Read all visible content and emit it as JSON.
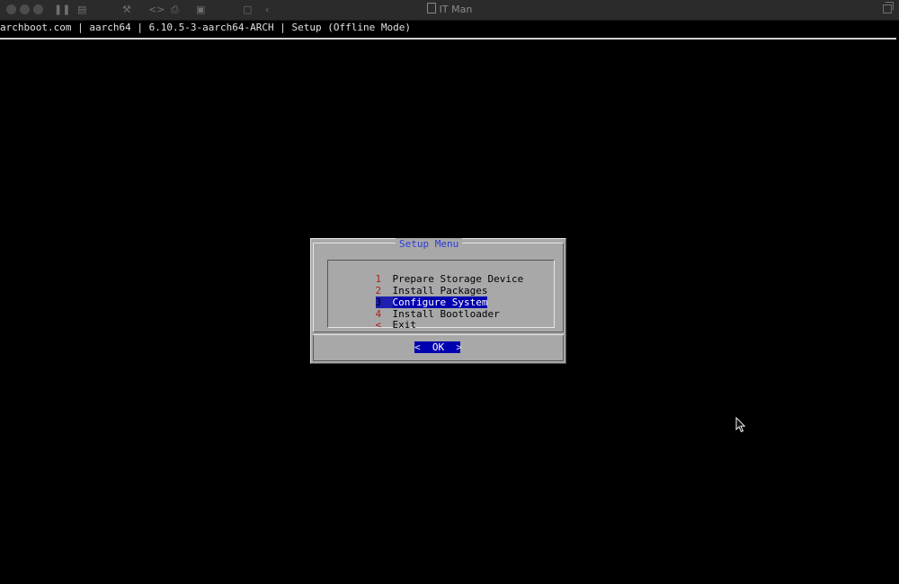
{
  "window": {
    "title": "IT Man"
  },
  "terminal": {
    "status_line": "archboot.com | aarch64 | 6.10.5-3-aarch64-ARCH | Setup (Offline Mode)"
  },
  "dialog": {
    "title": "Setup Menu",
    "items": [
      {
        "tag": "1",
        "label": "Prepare Storage Device",
        "selected": false
      },
      {
        "tag": "2",
        "label": "Install Packages",
        "selected": false
      },
      {
        "tag": "3",
        "label": "Configure System",
        "selected": true
      },
      {
        "tag": "4",
        "label": "Install Bootloader",
        "selected": false
      },
      {
        "tag": "<",
        "label": "Exit",
        "selected": false
      }
    ],
    "ok_button": {
      "label": "OK",
      "left_bracket": "<",
      "right_bracket": ">"
    }
  },
  "colors": {
    "dialog_bg": "#a8a8a8",
    "title_fg": "#2c3cd6",
    "tag_fg": "#b0201a",
    "selection_bg": "#0000b0",
    "terminal_bg": "#000000"
  },
  "icons": {
    "document": "document-icon",
    "pointer": "mouse-pointer-icon"
  }
}
